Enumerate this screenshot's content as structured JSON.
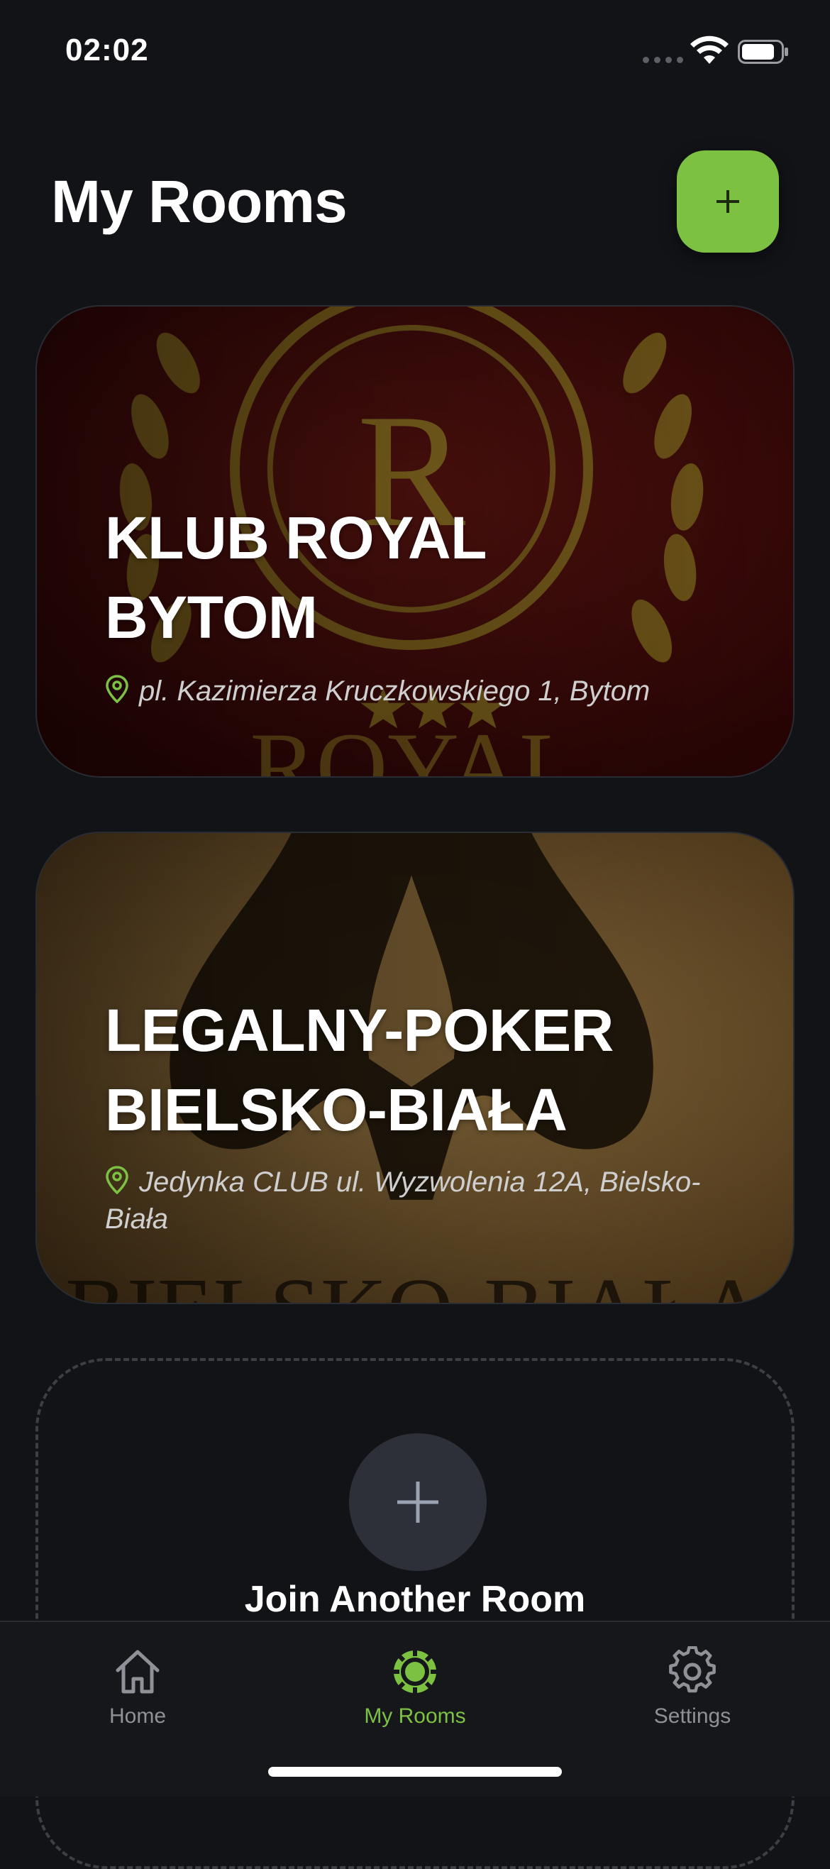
{
  "status_bar": {
    "time": "02:02"
  },
  "header": {
    "title": "My Rooms",
    "add_button_icon": "plus-icon"
  },
  "rooms": [
    {
      "name_line1": "KLUB ROYAL",
      "name_line2": "BYTOM",
      "address": "pl. Kazimierza Kruczkowskiego 1, Bytom",
      "background_icon": "royal-laurel-logo",
      "accent_color": "#3a0a0a"
    },
    {
      "name_line1": "LEGALNY-POKER",
      "name_line2": "BIELSKO-BIAŁA",
      "address": "Jedynka CLUB ul. Wyzwolenia 12A, Bielsko-Biała",
      "background_icon": "spade-logo",
      "accent_color": "#8a6a3a"
    }
  ],
  "join": {
    "label": "Join Another Room",
    "icon": "plus-icon"
  },
  "tabs": [
    {
      "label": "Home",
      "icon": "house-icon",
      "active": false
    },
    {
      "label": "My Rooms",
      "icon": "poker-chip-icon",
      "active": true
    },
    {
      "label": "Settings",
      "icon": "gear-icon",
      "active": false
    }
  ],
  "colors": {
    "accent": "#7dc143",
    "background": "#121317",
    "tab_inactive": "#8e9197"
  }
}
